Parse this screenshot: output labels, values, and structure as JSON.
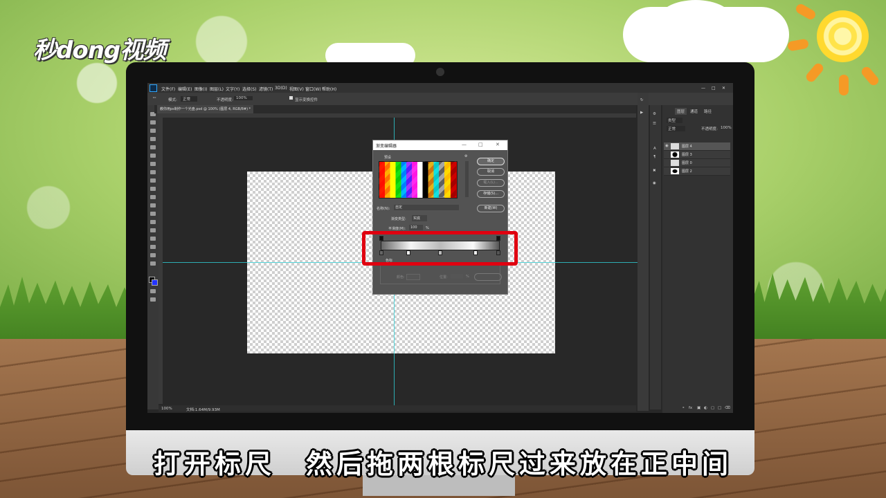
{
  "logo": {
    "text": "秒dong视频"
  },
  "photoshop": {
    "menu": [
      "文件(F)",
      "编辑(E)",
      "图像(I)",
      "图层(L)",
      "文字(Y)",
      "选择(S)",
      "滤镜(T)",
      "3D(D)",
      "视图(V)",
      "窗口(W)",
      "帮助(H)"
    ],
    "options": {
      "blend_label": "模式:",
      "blend_value": "正常",
      "opacity_label": "不透明度:",
      "opacity_value": "100%",
      "checkbox_label": "显示变换控件"
    },
    "document_tab": "教你用ps制作一个光盘.psd @ 100% (图层 4, RGB/8#) *",
    "status": {
      "zoom": "100%",
      "doc": "文档:1.64M/9.93M"
    },
    "panel_tabs": [
      "图层",
      "通道",
      "路径"
    ],
    "panel_fields": {
      "kind": "类型",
      "mode": "正常",
      "opacity_label": "不透明度:",
      "opacity_value": "100%"
    },
    "layers": [
      "图层 4",
      "图层 3",
      "图层 0",
      "图层 2"
    ]
  },
  "dialog": {
    "title": "渐变编辑器",
    "presets_label": "预设",
    "buttons": {
      "ok": "确定",
      "cancel": "取消",
      "load": "载入(L)...",
      "save": "存储(S)...",
      "new": "新建(W)"
    },
    "name_label": "名称(N):",
    "name_value": "自定",
    "type_label": "渐变类型:",
    "type_value": "实底",
    "smooth_label": "平滑度(M):",
    "smooth_value": "100",
    "smooth_unit": "%",
    "color_stops_label": "色标",
    "color_label": "颜色:",
    "location_label": "位置:",
    "location_unit": "%",
    "delete_label": "删除(D)"
  },
  "subtitle": "打开标尺　然后拖两根标尺过来放在正中间",
  "colors": {
    "highlight": "#e00010",
    "guide": "#2fd0d6"
  }
}
